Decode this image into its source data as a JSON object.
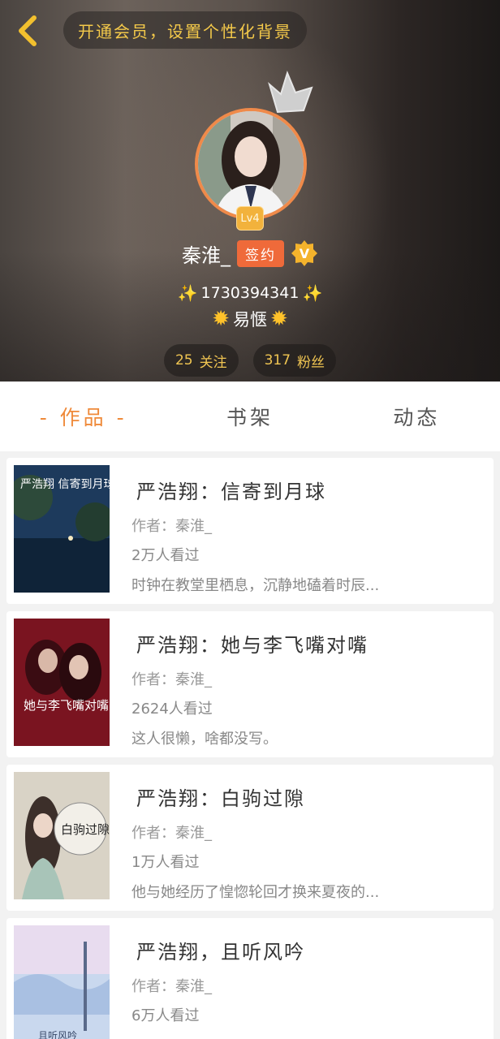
{
  "header": {
    "vip_text": "开通会员，设置个性化背景",
    "level": "Lv4",
    "username": "秦淮_",
    "signed_badge": "签约",
    "v_badge": "V",
    "user_id": "1730394341",
    "motto": "易惬",
    "follow_count": "25",
    "follow_label": "关注",
    "fans_count": "317",
    "fans_label": "粉丝"
  },
  "tabs": [
    {
      "label": "- 作品 -",
      "active": true
    },
    {
      "label": "书架",
      "active": false
    },
    {
      "label": "动态",
      "active": false
    }
  ],
  "books": [
    {
      "title": "严浩翔：信寄到月球",
      "author": "作者：秦淮_",
      "reads": "2万人看过",
      "desc": "时钟在教堂里栖息，沉静地磕着时辰...",
      "cover_text": "严浩翔 信寄到月球"
    },
    {
      "title": "严浩翔：她与李飞嘴对嘴",
      "author": "作者：秦淮_",
      "reads": "2624人看过",
      "desc": "这人很懒，啥都没写。",
      "cover_text": "她与李飞嘴对嘴"
    },
    {
      "title": "严浩翔：白驹过隙",
      "author": "作者：秦淮_",
      "reads": "1万人看过",
      "desc": "他与她经历了惶惚轮回才换来夏夜的...",
      "cover_text": "白驹过隙"
    },
    {
      "title": "严浩翔，且听风吟",
      "author": "作者：秦淮_",
      "reads": "6万人看过",
      "desc": "",
      "cover_text": "且听风吟"
    }
  ],
  "colors": {
    "accent": "#ef8a3a",
    "gold": "#f0c552",
    "signed": "#ef6a3a"
  }
}
